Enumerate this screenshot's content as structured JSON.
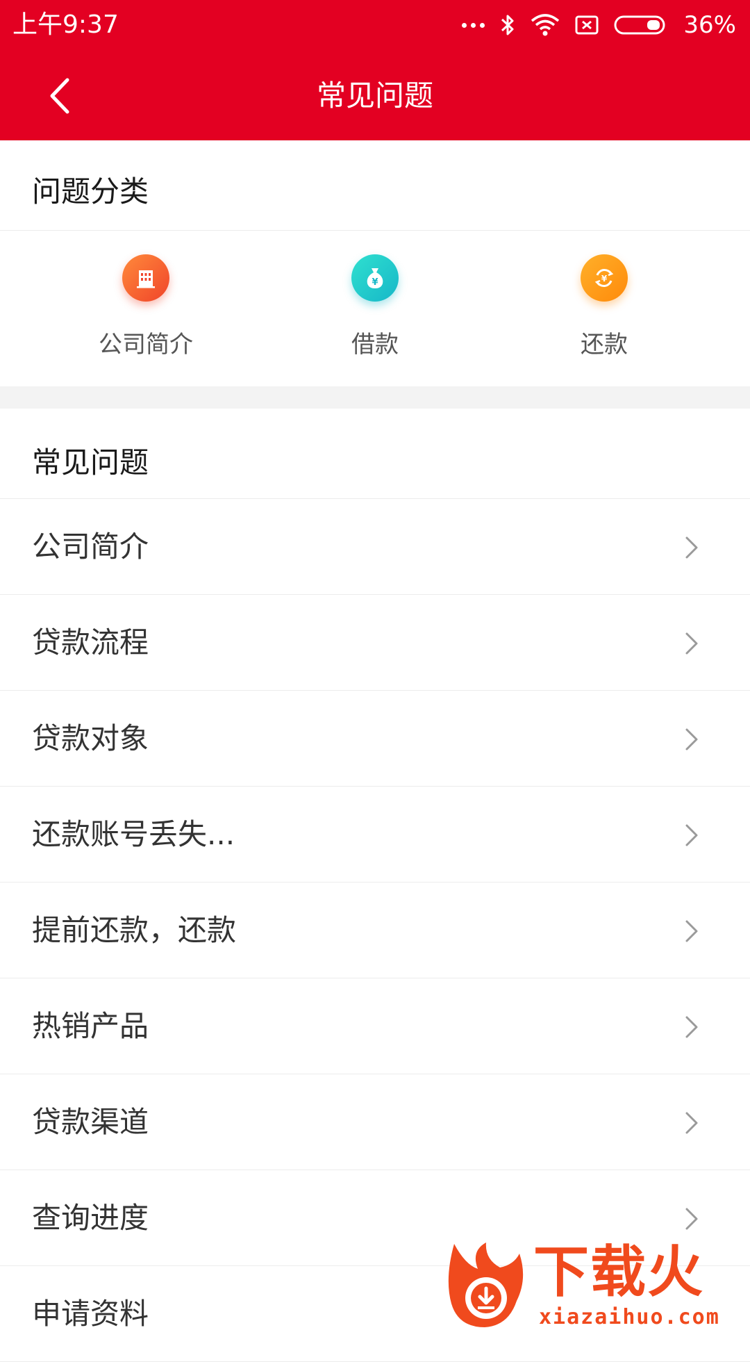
{
  "status_bar": {
    "time": "上午9:37",
    "battery": "36%"
  },
  "nav": {
    "title": "常见问题"
  },
  "categories": {
    "title": "问题分类",
    "items": [
      {
        "label": "公司简介",
        "icon": "building-icon",
        "color": "#f0442a"
      },
      {
        "label": "借款",
        "icon": "money-bag-icon",
        "color": "#17b7c8"
      },
      {
        "label": "还款",
        "icon": "repay-cycle-icon",
        "color": "#ff8a0a"
      }
    ]
  },
  "faq": {
    "title": "常见问题",
    "items": [
      {
        "label": "公司简介"
      },
      {
        "label": "贷款流程"
      },
      {
        "label": "贷款对象"
      },
      {
        "label": "还款账号丢失..."
      },
      {
        "label": "提前还款，还款"
      },
      {
        "label": "热销产品"
      },
      {
        "label": "贷款渠道"
      },
      {
        "label": "查询进度"
      },
      {
        "label": "申请资料"
      }
    ]
  },
  "watermark": {
    "title": "下载火",
    "domain": "xiazaihuo.com"
  },
  "colors": {
    "header_bg": "#e30022",
    "divider": "#ececec",
    "section_gap": "#f3f3f3"
  }
}
